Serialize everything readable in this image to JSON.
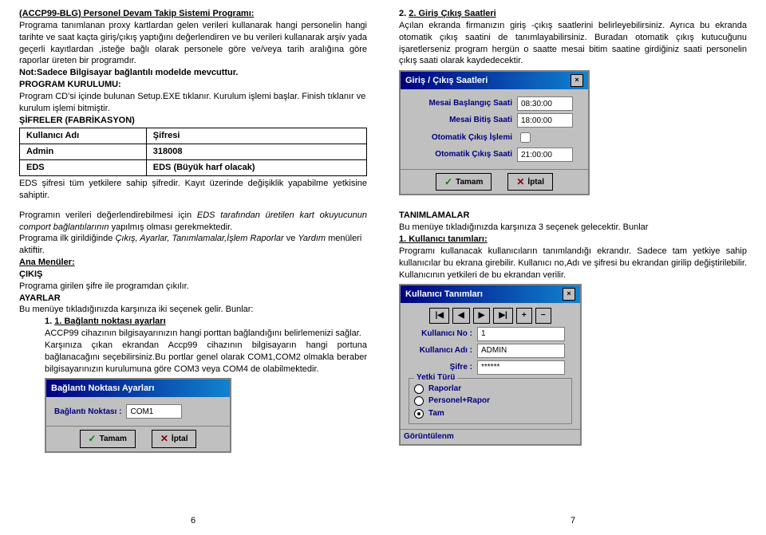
{
  "left": {
    "title_line": "(ACCP99-BLG) Personel Devam Takip Sistemi Programı:",
    "p1": "Programa tanımlanan proxy kartlardan gelen verileri kullanarak hangi personelin hangi tarihte ve saat kaçta giriş/çıkış yaptığını değerlendiren ve bu verileri kullanarak arşiv yada geçerli kayıtlardan ,isteğe bağlı olarak personele göre ve/veya tarih aralığına göre raporlar üreten bir programdır.",
    "note": "Not:Sadece Bilgisayar bağlantılı modelde mevcuttur.",
    "kurulumu": "PROGRAM KURULUMU:",
    "kurulumu_t": "Program CD'si içinde bulunan Setup.EXE tıklanır. Kurulum işlemi başlar. Finish tıklanır ve kurulum işlemi bitmiştir.",
    "sifreler": "ŞİFRELER (FABRİKASYON)",
    "th1": "Kullanıcı Adı",
    "th2": "Şifresi",
    "r1c1": "Admin",
    "r1c2": "318008",
    "r2c1": "EDS",
    "r2c2": "EDS  (Büyük harf olacak)",
    "eds_note": "EDS şifresi tüm yetkilere sahip şifredir. Kayıt üzerinde değişiklik yapabilme yetkisine sahiptir.",
    "p2a": "Programın verileri değerlendirebilmesi için ",
    "p2b": "EDS tarafından üretilen kart okuyucunun comport bağlantılarının",
    "p2c": " yapılmış olması gerekmektedir.",
    "p3a": "Programa ilk girildiğinde ",
    "p3b": "Çıkış, Ayarlar, Tanımlamalar,İşlem Raporlar",
    "p3c": " ve ",
    "p3d": "Yardım",
    "p3e": " menüleri aktiftir.",
    "ana_menuler": "Ana Menüler:",
    "cikis": "ÇIKIŞ",
    "cikis_t": "Programa girilen şifre ile programdan çıkılır.",
    "ayarlar": "AYARLAR",
    "ayarlar_t": "Bu menüye tıkladığınızda karşınıza iki seçenek gelir. Bunlar:",
    "opt1_h": "1. Bağlantı noktası ayarları",
    "opt1_t": "ACCP99 cihazının bilgisayarınızın hangi porttan bağlandığını belirlemenizi sağlar.",
    "opt1_t2": "Karşınıza çıkan ekrandan Accp99 cihazının bilgisayarın hangi portuna bağlanacağını seçebilirsiniz.Bu portlar genel olarak COM1,COM2 olmakla beraber bilgisayarınızın kurulumuna göre COM3 veya COM4 de olabilmektedir.",
    "dlg1_title": "Bağlantı Noktası Ayarları",
    "dlg1_lbl": "Bağlantı Noktası :",
    "dlg1_val": "COM1",
    "btn_tamam": "Tamam",
    "btn_iptal": "İptal",
    "pnum": "6"
  },
  "right": {
    "h2": "2. Giriş Çıkış Saatleri",
    "p1": "Açılan ekranda firmanızın giriş -çıkış saatlerini belirleyebilirsiniz. Ayrıca bu ekranda otomatik çıkış saatini de tanımlayabilirsiniz. Buradan otomatik çıkış kutucuğunu işaretlerseniz program hergün o saatte mesai bitim saatine girdiğiniz saati personelin çıkış saati olarak kaydedecektir.",
    "dlg2_title": "Giriş / Çıkış Saatleri",
    "lbl_mb": "Mesai Başlangıç Saati",
    "v_mb": "08:30:00",
    "lbl_me": "Mesai Bitiş Saati",
    "v_me": "18:00:00",
    "lbl_oci": "Otomatik Çıkış İşlemi",
    "lbl_ocs": "Otomatik Çıkış Saati",
    "v_ocs": "21:00:00",
    "tanimlamalar": "TANIMLAMALAR",
    "tanimlamalar_t": "Bu menüye tıkladığınızda karşınıza 3 seçenek gelecektir. Bunlar",
    "kt_h": "1. Kullanıcı tanımları:",
    "kt_t": "Programı kullanacak kullanıcıların tanımlandığı ekrandır. Sadece tam yetkiye sahip kullanıcılar bu ekrana girebilir. Kullanıcı no,Adı ve şifresi bu ekrandan girilip değiştirilebilir. Kullanıcının yetkileri de bu ekrandan verilir.",
    "dlg3_title": "Kullanıcı Tanımları",
    "lbl_kno": "Kullanıcı No :",
    "v_kno": "1",
    "lbl_kadi": "Kullanıcı Adı :",
    "v_kadi": "ADMIN",
    "lbl_sifre": "Şifre :",
    "v_sifre": "******",
    "yetki_leg": "Yetki Türü",
    "y1": "Raporlar",
    "y2": "Personel+Rapor",
    "y3": "Tam",
    "goruntulenm": "Görüntülenm",
    "pnum": "7"
  }
}
